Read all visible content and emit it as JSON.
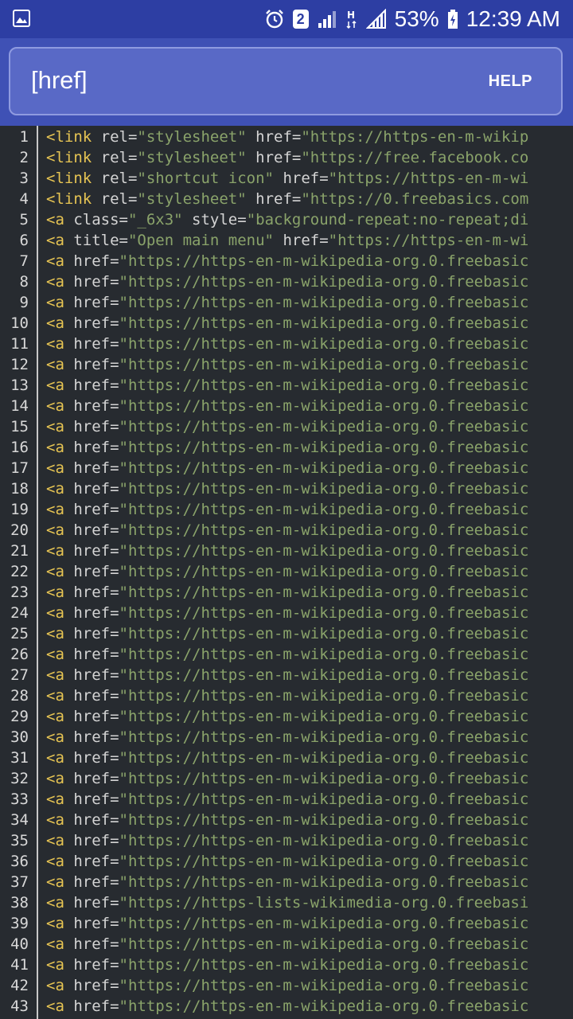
{
  "status_bar": {
    "time": "12:39 AM",
    "battery": "53%",
    "notification_badge": "2",
    "icons": [
      "image-icon",
      "alarm-icon",
      "sim-2-icon",
      "signal-icon",
      "data-h-icon",
      "signal-icon-2",
      "battery-charging-icon"
    ]
  },
  "header": {
    "query": "[href]",
    "help_label": "HELP"
  },
  "lines": [
    {
      "num": "1",
      "tokens": [
        [
          "tg",
          "<link"
        ],
        [
          "at",
          " rel="
        ],
        [
          "st",
          "\"stylesheet\""
        ],
        [
          "at",
          " href="
        ],
        [
          "st",
          "\"https://https-en-m-wikip"
        ]
      ]
    },
    {
      "num": "2",
      "tokens": [
        [
          "tg",
          "<link"
        ],
        [
          "at",
          " rel="
        ],
        [
          "st",
          "\"stylesheet\""
        ],
        [
          "at",
          " href="
        ],
        [
          "st",
          "\"https://free.facebook.co"
        ]
      ]
    },
    {
      "num": "3",
      "tokens": [
        [
          "tg",
          "<link"
        ],
        [
          "at",
          " rel="
        ],
        [
          "st",
          "\"shortcut icon\""
        ],
        [
          "at",
          " href="
        ],
        [
          "st",
          "\"https://https-en-m-wi"
        ]
      ]
    },
    {
      "num": "4",
      "tokens": [
        [
          "tg",
          "<link"
        ],
        [
          "at",
          " rel="
        ],
        [
          "st",
          "\"stylesheet\""
        ],
        [
          "at",
          " href="
        ],
        [
          "st",
          "\"https://0.freebasics.com"
        ]
      ]
    },
    {
      "num": "5",
      "tokens": [
        [
          "tg",
          "<a"
        ],
        [
          "at",
          " class="
        ],
        [
          "st",
          "\"_6x3\""
        ],
        [
          "at",
          " style="
        ],
        [
          "st",
          "\"background-repeat:no-repeat;di"
        ]
      ]
    },
    {
      "num": "6",
      "tokens": [
        [
          "tg",
          "<a"
        ],
        [
          "at",
          " title="
        ],
        [
          "st",
          "\"Open main menu\""
        ],
        [
          "at",
          " href="
        ],
        [
          "st",
          "\"https://https-en-m-wi"
        ]
      ]
    },
    {
      "num": "7",
      "tokens": [
        [
          "tg",
          "<a"
        ],
        [
          "at",
          " href="
        ],
        [
          "st",
          "\"https://https-en-m-wikipedia-org.0.freebasic"
        ]
      ]
    },
    {
      "num": "8",
      "tokens": [
        [
          "tg",
          "<a"
        ],
        [
          "at",
          " href="
        ],
        [
          "st",
          "\"https://https-en-m-wikipedia-org.0.freebasic"
        ]
      ]
    },
    {
      "num": "9",
      "tokens": [
        [
          "tg",
          "<a"
        ],
        [
          "at",
          " href="
        ],
        [
          "st",
          "\"https://https-en-m-wikipedia-org.0.freebasic"
        ]
      ]
    },
    {
      "num": "10",
      "tokens": [
        [
          "tg",
          "<a"
        ],
        [
          "at",
          " href="
        ],
        [
          "st",
          "\"https://https-en-m-wikipedia-org.0.freebasic"
        ]
      ]
    },
    {
      "num": "11",
      "tokens": [
        [
          "tg",
          "<a"
        ],
        [
          "at",
          " href="
        ],
        [
          "st",
          "\"https://https-en-m-wikipedia-org.0.freebasic"
        ]
      ]
    },
    {
      "num": "12",
      "tokens": [
        [
          "tg",
          "<a"
        ],
        [
          "at",
          " href="
        ],
        [
          "st",
          "\"https://https-en-m-wikipedia-org.0.freebasic"
        ]
      ]
    },
    {
      "num": "13",
      "tokens": [
        [
          "tg",
          "<a"
        ],
        [
          "at",
          " href="
        ],
        [
          "st",
          "\"https://https-en-m-wikipedia-org.0.freebasic"
        ]
      ]
    },
    {
      "num": "14",
      "tokens": [
        [
          "tg",
          "<a"
        ],
        [
          "at",
          " href="
        ],
        [
          "st",
          "\"https://https-en-m-wikipedia-org.0.freebasic"
        ]
      ]
    },
    {
      "num": "15",
      "tokens": [
        [
          "tg",
          "<a"
        ],
        [
          "at",
          " href="
        ],
        [
          "st",
          "\"https://https-en-m-wikipedia-org.0.freebasic"
        ]
      ]
    },
    {
      "num": "16",
      "tokens": [
        [
          "tg",
          "<a"
        ],
        [
          "at",
          " href="
        ],
        [
          "st",
          "\"https://https-en-m-wikipedia-org.0.freebasic"
        ]
      ]
    },
    {
      "num": "17",
      "tokens": [
        [
          "tg",
          "<a"
        ],
        [
          "at",
          " href="
        ],
        [
          "st",
          "\"https://https-en-m-wikipedia-org.0.freebasic"
        ]
      ]
    },
    {
      "num": "18",
      "tokens": [
        [
          "tg",
          "<a"
        ],
        [
          "at",
          " href="
        ],
        [
          "st",
          "\"https://https-en-m-wikipedia-org.0.freebasic"
        ]
      ]
    },
    {
      "num": "19",
      "tokens": [
        [
          "tg",
          "<a"
        ],
        [
          "at",
          " href="
        ],
        [
          "st",
          "\"https://https-en-m-wikipedia-org.0.freebasic"
        ]
      ]
    },
    {
      "num": "20",
      "tokens": [
        [
          "tg",
          "<a"
        ],
        [
          "at",
          " href="
        ],
        [
          "st",
          "\"https://https-en-m-wikipedia-org.0.freebasic"
        ]
      ]
    },
    {
      "num": "21",
      "tokens": [
        [
          "tg",
          "<a"
        ],
        [
          "at",
          " href="
        ],
        [
          "st",
          "\"https://https-en-m-wikipedia-org.0.freebasic"
        ]
      ]
    },
    {
      "num": "22",
      "tokens": [
        [
          "tg",
          "<a"
        ],
        [
          "at",
          " href="
        ],
        [
          "st",
          "\"https://https-en-m-wikipedia-org.0.freebasic"
        ]
      ]
    },
    {
      "num": "23",
      "tokens": [
        [
          "tg",
          "<a"
        ],
        [
          "at",
          " href="
        ],
        [
          "st",
          "\"https://https-en-m-wikipedia-org.0.freebasic"
        ]
      ]
    },
    {
      "num": "24",
      "tokens": [
        [
          "tg",
          "<a"
        ],
        [
          "at",
          " href="
        ],
        [
          "st",
          "\"https://https-en-m-wikipedia-org.0.freebasic"
        ]
      ]
    },
    {
      "num": "25",
      "tokens": [
        [
          "tg",
          "<a"
        ],
        [
          "at",
          " href="
        ],
        [
          "st",
          "\"https://https-en-m-wikipedia-org.0.freebasic"
        ]
      ]
    },
    {
      "num": "26",
      "tokens": [
        [
          "tg",
          "<a"
        ],
        [
          "at",
          " href="
        ],
        [
          "st",
          "\"https://https-en-m-wikipedia-org.0.freebasic"
        ]
      ]
    },
    {
      "num": "27",
      "tokens": [
        [
          "tg",
          "<a"
        ],
        [
          "at",
          " href="
        ],
        [
          "st",
          "\"https://https-en-m-wikipedia-org.0.freebasic"
        ]
      ]
    },
    {
      "num": "28",
      "tokens": [
        [
          "tg",
          "<a"
        ],
        [
          "at",
          " href="
        ],
        [
          "st",
          "\"https://https-en-m-wikipedia-org.0.freebasic"
        ]
      ]
    },
    {
      "num": "29",
      "tokens": [
        [
          "tg",
          "<a"
        ],
        [
          "at",
          " href="
        ],
        [
          "st",
          "\"https://https-en-m-wikipedia-org.0.freebasic"
        ]
      ]
    },
    {
      "num": "30",
      "tokens": [
        [
          "tg",
          "<a"
        ],
        [
          "at",
          " href="
        ],
        [
          "st",
          "\"https://https-en-m-wikipedia-org.0.freebasic"
        ]
      ]
    },
    {
      "num": "31",
      "tokens": [
        [
          "tg",
          "<a"
        ],
        [
          "at",
          " href="
        ],
        [
          "st",
          "\"https://https-en-m-wikipedia-org.0.freebasic"
        ]
      ]
    },
    {
      "num": "32",
      "tokens": [
        [
          "tg",
          "<a"
        ],
        [
          "at",
          " href="
        ],
        [
          "st",
          "\"https://https-en-m-wikipedia-org.0.freebasic"
        ]
      ]
    },
    {
      "num": "33",
      "tokens": [
        [
          "tg",
          "<a"
        ],
        [
          "at",
          " href="
        ],
        [
          "st",
          "\"https://https-en-m-wikipedia-org.0.freebasic"
        ]
      ]
    },
    {
      "num": "34",
      "tokens": [
        [
          "tg",
          "<a"
        ],
        [
          "at",
          " href="
        ],
        [
          "st",
          "\"https://https-en-m-wikipedia-org.0.freebasic"
        ]
      ]
    },
    {
      "num": "35",
      "tokens": [
        [
          "tg",
          "<a"
        ],
        [
          "at",
          " href="
        ],
        [
          "st",
          "\"https://https-en-m-wikipedia-org.0.freebasic"
        ]
      ]
    },
    {
      "num": "36",
      "tokens": [
        [
          "tg",
          "<a"
        ],
        [
          "at",
          " href="
        ],
        [
          "st",
          "\"https://https-en-m-wikipedia-org.0.freebasic"
        ]
      ]
    },
    {
      "num": "37",
      "tokens": [
        [
          "tg",
          "<a"
        ],
        [
          "at",
          " href="
        ],
        [
          "st",
          "\"https://https-en-m-wikipedia-org.0.freebasic"
        ]
      ]
    },
    {
      "num": "38",
      "tokens": [
        [
          "tg",
          "<a"
        ],
        [
          "at",
          " href="
        ],
        [
          "st",
          "\"https://https-lists-wikimedia-org.0.freebasi"
        ]
      ]
    },
    {
      "num": "39",
      "tokens": [
        [
          "tg",
          "<a"
        ],
        [
          "at",
          " href="
        ],
        [
          "st",
          "\"https://https-en-m-wikipedia-org.0.freebasic"
        ]
      ]
    },
    {
      "num": "40",
      "tokens": [
        [
          "tg",
          "<a"
        ],
        [
          "at",
          " href="
        ],
        [
          "st",
          "\"https://https-en-m-wikipedia-org.0.freebasic"
        ]
      ]
    },
    {
      "num": "41",
      "tokens": [
        [
          "tg",
          "<a"
        ],
        [
          "at",
          " href="
        ],
        [
          "st",
          "\"https://https-en-m-wikipedia-org.0.freebasic"
        ]
      ]
    },
    {
      "num": "42",
      "tokens": [
        [
          "tg",
          "<a"
        ],
        [
          "at",
          " href="
        ],
        [
          "st",
          "\"https://https-en-m-wikipedia-org.0.freebasic"
        ]
      ]
    },
    {
      "num": "43",
      "tokens": [
        [
          "tg",
          "<a"
        ],
        [
          "at",
          " href="
        ],
        [
          "st",
          "\"https://https-en-m-wikipedia-org.0.freebasic"
        ]
      ]
    }
  ]
}
